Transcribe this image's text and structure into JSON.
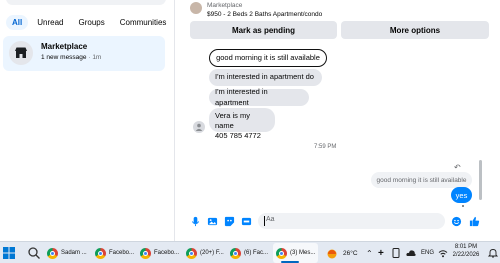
{
  "sidebar": {
    "filters": [
      {
        "label": "All",
        "active": true
      },
      {
        "label": "Unread",
        "active": false
      },
      {
        "label": "Groups",
        "active": false
      },
      {
        "label": "Communities",
        "active": false
      }
    ],
    "conversation": {
      "name": "Marketplace",
      "preview": "1 new message",
      "time": "· 1m",
      "icon": "storefront-icon"
    }
  },
  "chat": {
    "header": {
      "source": "Marketplace",
      "title": "$950 - 2 Beds 2 Baths Apartment/condo"
    },
    "actions": {
      "pending_label": "Mark as pending",
      "more_label": "More options"
    },
    "messages": [
      {
        "text": "good morning it is still available"
      },
      {
        "text": "I'm interested in apartment do"
      },
      {
        "text": "I'm interested in apartment"
      },
      {
        "text": "Vera is my name\n405 785 4772"
      }
    ],
    "timestamp": "7:59 PM",
    "reply": {
      "quoted": "good morning it is still available",
      "text": "yes"
    },
    "composer": {
      "placeholder": "Aa"
    },
    "colors": {
      "accent": "#0084ff",
      "bubble": "#e4e6eb"
    }
  },
  "taskbar": {
    "items": [
      {
        "label": "Sadam ...",
        "active": false
      },
      {
        "label": "Facebo...",
        "active": false
      },
      {
        "label": "Facebo...",
        "active": false
      },
      {
        "label": "(20+) F...",
        "active": false
      },
      {
        "label": "(6) Fac...",
        "active": false
      },
      {
        "label": "(3) Mes...",
        "active": true
      }
    ],
    "weather": "26°C",
    "language": "ENG",
    "time": "8:01 PM",
    "date": "2/22/2026"
  }
}
